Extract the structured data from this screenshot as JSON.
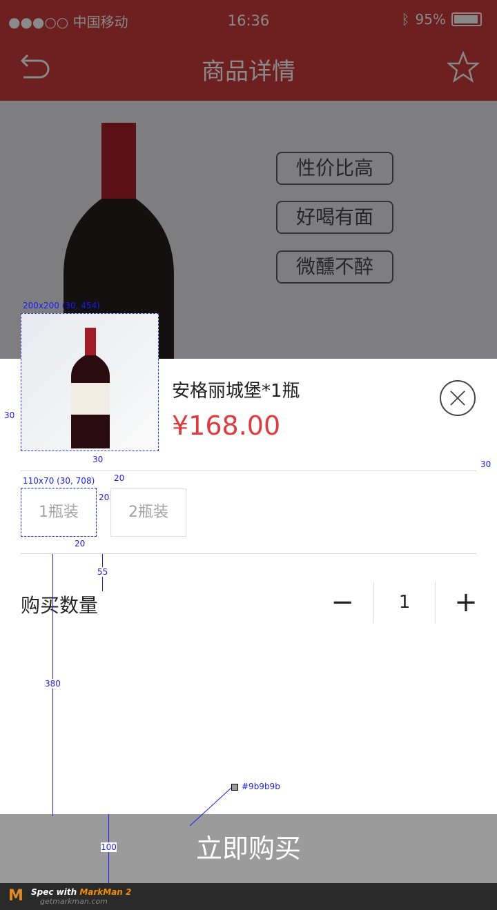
{
  "status": {
    "carrier": "●●●○○ 中国移动",
    "time": "16:36",
    "battery": "95%",
    "battery_level": 95
  },
  "nav": {
    "title": "商品详情",
    "back_icon": "back-arrow-icon",
    "favorite_icon": "star-icon"
  },
  "hero": {
    "tags": [
      "性价比高",
      "好喝有面",
      "微醺不醉"
    ]
  },
  "sheet": {
    "product_name": "安格丽城堡*1瓶",
    "price": "¥168.00",
    "options": [
      "1瓶装",
      "2瓶装"
    ],
    "quantity_label": "购买数量",
    "quantity": "1",
    "minus": "−",
    "plus": "+"
  },
  "buy_button": "立即购买",
  "annotations": {
    "thumb": "200x200 (30, 454)",
    "opt": "110x70 (30, 708)",
    "a30l": "30",
    "a30b": "30",
    "a30r": "30",
    "a20a": "20",
    "a20b": "20",
    "a20c": "20",
    "a55": "55",
    "a380": "380",
    "a100": "100",
    "color": "#9b9b9b"
  },
  "footer": {
    "spec": "Spec with ",
    "brand": "MarkMan 2",
    "site": "getmarkman.com"
  },
  "colors": {
    "header": "#6e1f20",
    "price": "#e03a3e",
    "buy": "#9b9b9b"
  }
}
